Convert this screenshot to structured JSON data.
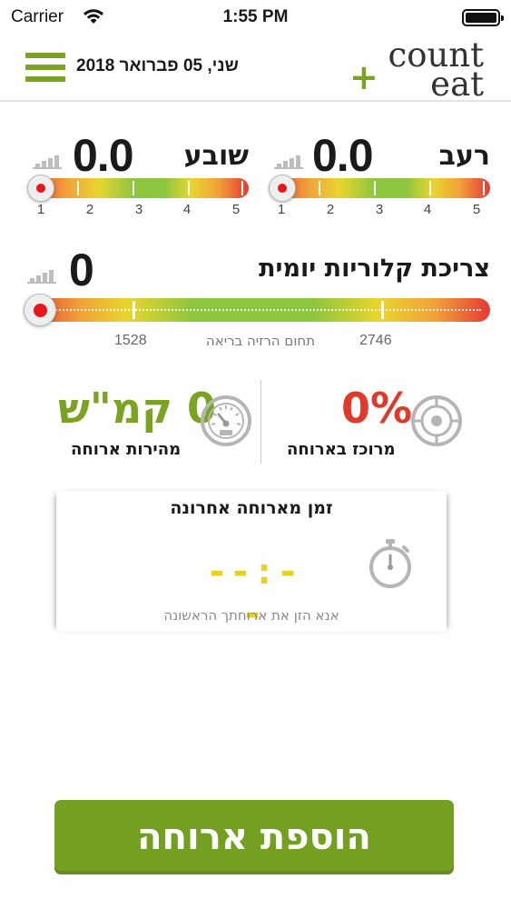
{
  "status_bar": {
    "carrier": "Carrier",
    "time": "1:55 PM"
  },
  "header": {
    "date": "שני, 05 פברואר 2018",
    "logo_word1": "count",
    "logo_word2": "eat",
    "logo_plus": "+"
  },
  "hunger": {
    "label": "רעב",
    "value": "0.0",
    "scale_labels": [
      "1",
      "2",
      "3",
      "4",
      "5"
    ],
    "level": 0
  },
  "satiety": {
    "label": "שובע",
    "value": "0.0",
    "scale_labels": [
      "1",
      "2",
      "3",
      "4",
      "5"
    ],
    "level": 0
  },
  "daily_calories": {
    "label": "צריכת קלוריות יומית",
    "value": "0",
    "range_low": "1528",
    "range_high": "2746",
    "range_label": "תחום הרזיה בריאה"
  },
  "meal_focus": {
    "value": "0%",
    "caption": "מרוכז בארוחה"
  },
  "meal_speed": {
    "value": "0 קמ\"ש",
    "caption": "מהירות ארוחה"
  },
  "last_meal": {
    "title": "זמן מארוחה אחרונה",
    "timer": "--:--",
    "hint": "אנא הזן את ארוחתך הראשונה"
  },
  "add_meal_button": "הוספת ארוחה",
  "colors": {
    "brand_green": "#7aa321",
    "focus_red": "#e03a2b",
    "timer_yellow": "#e8d21e"
  },
  "icons": [
    "wifi-icon",
    "battery-icon",
    "menu-icon",
    "bar-chart-icon",
    "speedometer-icon",
    "target-icon",
    "stopwatch-icon"
  ]
}
